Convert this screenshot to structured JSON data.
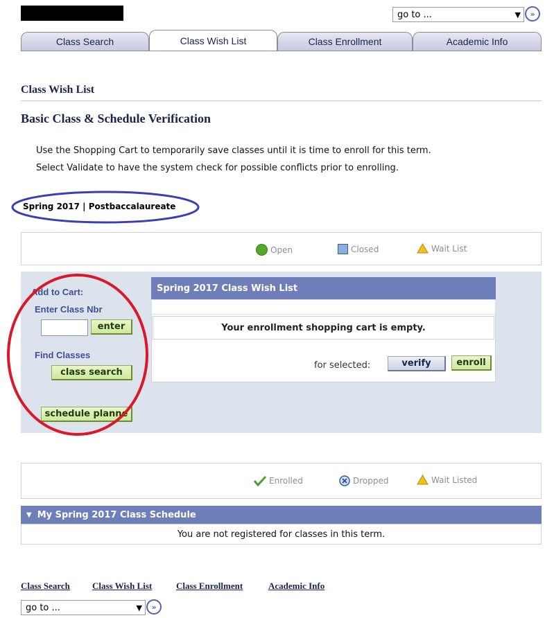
{
  "top": {
    "goto_label": "go to ..."
  },
  "tabs": [
    "Class Search",
    "Class Wish List",
    "Class Enrollment",
    "Academic Info"
  ],
  "page_title": "Class Wish List",
  "subtitle": "Basic Class & Schedule Verification",
  "instructions": [
    "Use the Shopping Cart to temporarily save classes until it is time to enroll for this term.",
    "Select Validate to have the system check for possible conflicts prior to enrolling."
  ],
  "term": "Spring 2017 | Postbaccalaureate",
  "legend_top": {
    "open": "Open",
    "closed": "Closed",
    "waitlist": "Wait List"
  },
  "add_to_cart": {
    "title": "Add to Cart:",
    "enter_label": "Enter Class Nbr",
    "enter_value": "",
    "enter_button": "enter",
    "find_label": "Find Classes",
    "search_button": "class search",
    "planner_button": "schedule planne"
  },
  "wish_list": {
    "header": "Spring 2017 Class Wish List",
    "empty_msg": "Your enrollment shopping cart is empty.",
    "for_selected": "for selected:",
    "verify_button": "verify",
    "enroll_button": "enroll"
  },
  "legend_bottom": {
    "enrolled": "Enrolled",
    "dropped": "Dropped",
    "waitlisted": "Wait Listed"
  },
  "schedule": {
    "header": "My Spring 2017 Class Schedule",
    "msg": "You are not registered for classes in this term."
  },
  "footer_links": [
    "Class Search",
    "Class Wish List",
    "Class Enrollment",
    "Academic Info"
  ],
  "colors": {
    "annotation_blue": "#3a3db5",
    "annotation_red": "#d8192c",
    "accent": "#6d7eb8"
  }
}
